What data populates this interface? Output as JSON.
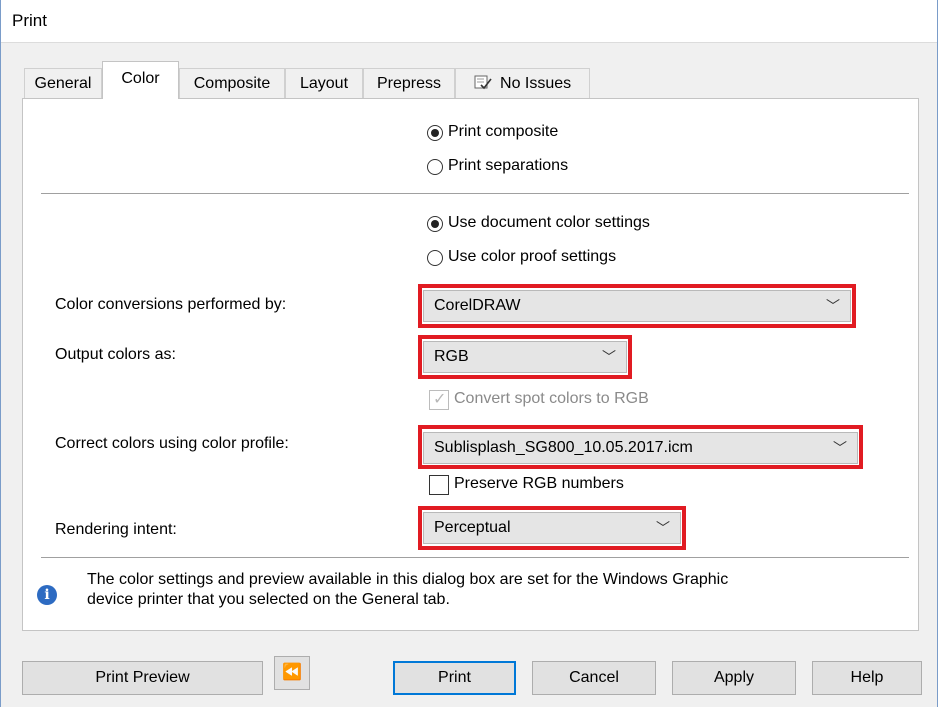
{
  "window": {
    "title": "Print"
  },
  "tabs": [
    {
      "label": "General"
    },
    {
      "label": "Color"
    },
    {
      "label": "Composite"
    },
    {
      "label": "Layout"
    },
    {
      "label": "Prepress"
    },
    {
      "label": "No Issues",
      "icon": "issues-check-icon"
    }
  ],
  "print_mode": {
    "options": [
      "Print composite",
      "Print separations"
    ],
    "selected": "Print composite"
  },
  "color_settings": {
    "options": [
      "Use document color settings",
      "Use color proof settings"
    ],
    "selected": "Use document color settings"
  },
  "conversions": {
    "label": "Color conversions performed by:",
    "value": "CorelDRAW"
  },
  "output": {
    "label": "Output colors as:",
    "value": "RGB"
  },
  "convert_spot": {
    "label": "Convert spot colors to RGB",
    "checked": true,
    "enabled": false
  },
  "profile": {
    "label": "Correct colors using color profile:",
    "value": "Sublisplash_SG800_10.05.2017.icm"
  },
  "preserve_rgb": {
    "label": "Preserve RGB numbers",
    "checked": false
  },
  "rendering": {
    "label": "Rendering intent:",
    "value": "Perceptual"
  },
  "info": {
    "line1": "The color settings and preview available in this dialog box are set for the Windows Graphic",
    "line2": "device printer that you selected on the General tab."
  },
  "buttons": {
    "print_preview": "Print Preview",
    "back_glyph": "⏪",
    "print": "Print",
    "cancel": "Cancel",
    "apply": "Apply",
    "help": "Help"
  },
  "colors": {
    "highlight": "#e11b22",
    "accent": "#0078d7",
    "info_icon": "#2d6bc2"
  }
}
